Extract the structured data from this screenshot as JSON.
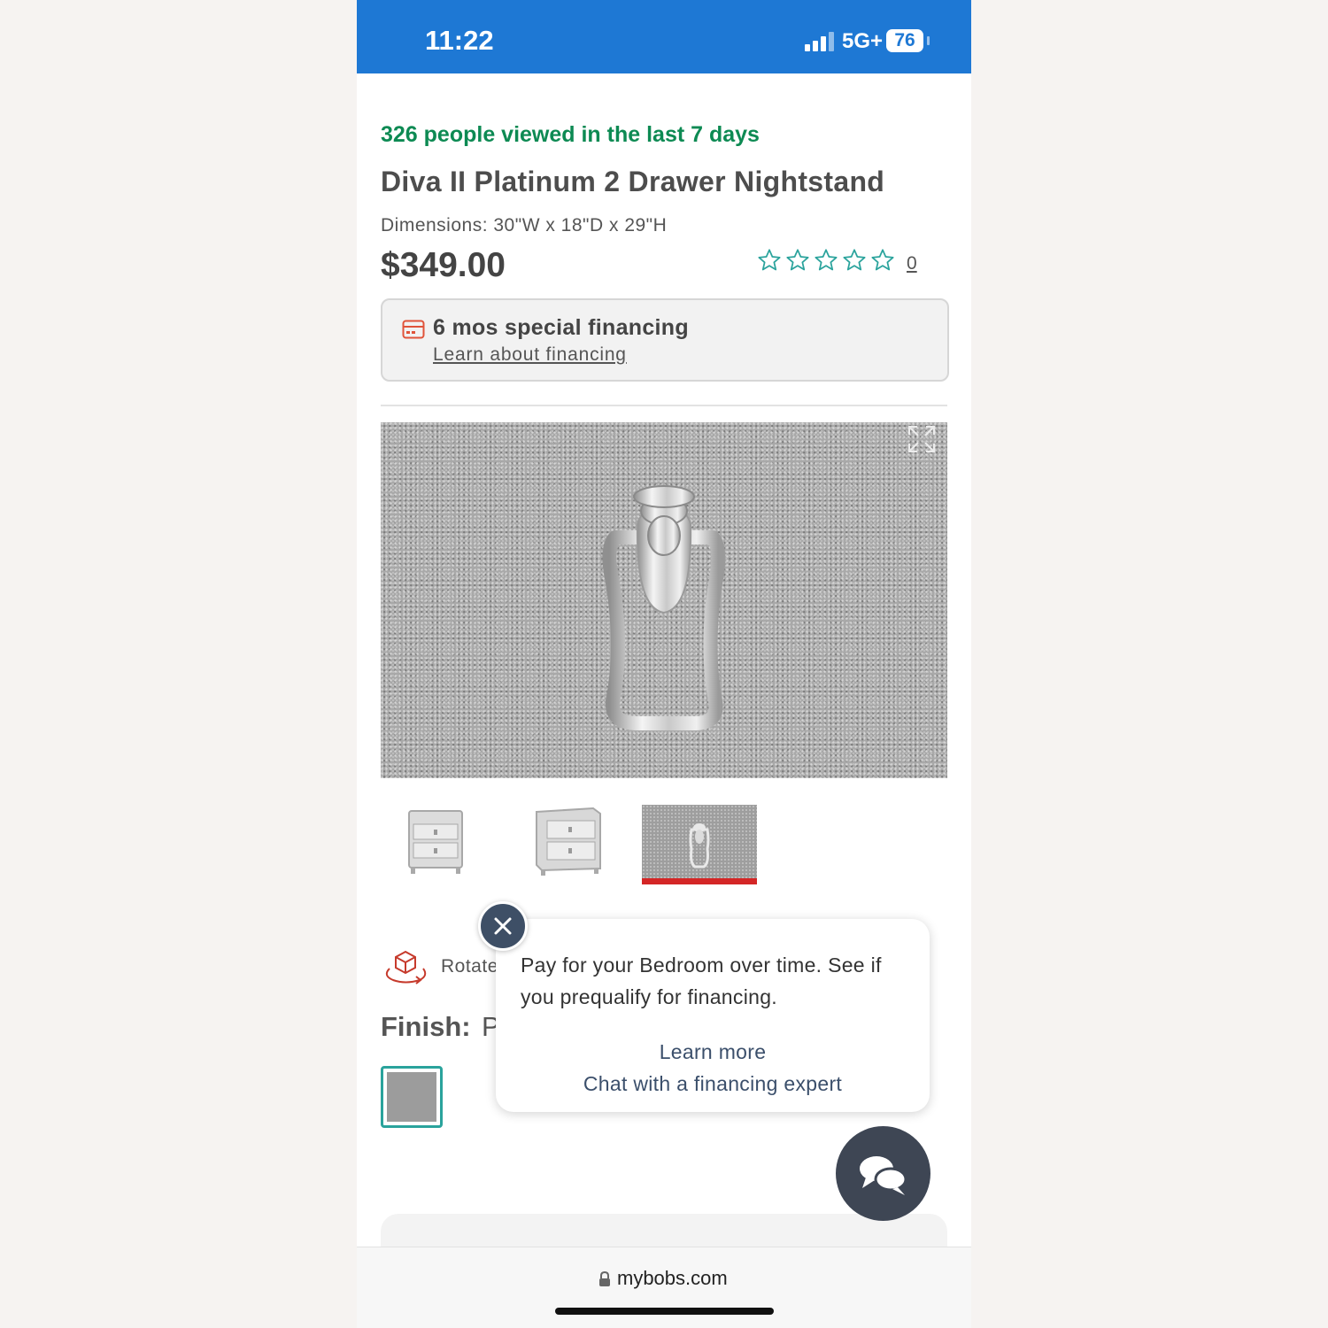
{
  "status_bar": {
    "time": "11:22",
    "network": "5G+",
    "battery": "76"
  },
  "product": {
    "viewed_notice": "326 people viewed in the last 7 days",
    "title": "Diva II Platinum 2 Drawer Nightstand",
    "dimensions": "Dimensions: 30\"W x 18\"D x 29\"H",
    "price": "$349.00",
    "rating": {
      "stars_filled": 0,
      "stars_total": 5,
      "review_count": "0"
    }
  },
  "financing": {
    "title": "6 mos special financing",
    "link": "Learn about financing"
  },
  "gallery": {
    "thumbnail_count": 3,
    "selected_index": 2
  },
  "rotate": {
    "label": "Rotate"
  },
  "finish": {
    "label": "Finish:",
    "value": "P",
    "swatch_color": "#9c9c9c"
  },
  "popup": {
    "message": "Pay for your Bedroom over time. See if you prequalify for financing.",
    "learn_more": "Learn more",
    "chat_link": "Chat with a financing expert"
  },
  "browser": {
    "url": "mybobs.com"
  },
  "colors": {
    "status_bar": "#1e78d4",
    "viewed_green": "#0d8a53",
    "star_teal": "#2aa39c",
    "accent_red": "#d42626",
    "chat_button": "#3e4654"
  }
}
